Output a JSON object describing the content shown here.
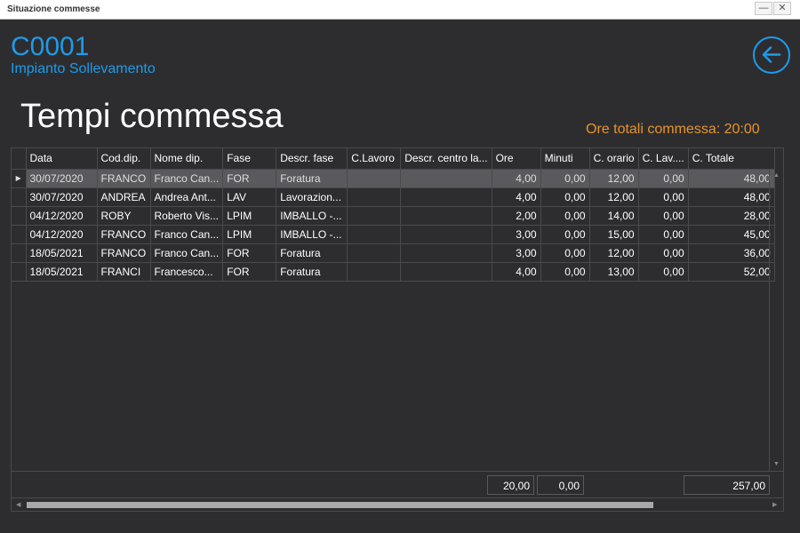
{
  "window": {
    "title": "Situazione commesse",
    "minimize": "—",
    "close": "✕"
  },
  "header": {
    "code": "C0001",
    "description": "Impianto Sollevamento",
    "heading": "Tempi commessa",
    "total_hours": "Ore totali commessa: 20:00"
  },
  "colors": {
    "accent": "#1e9be8",
    "total": "#e8932a",
    "background": "#2d2d30"
  },
  "table": {
    "columns": [
      "Data",
      "Cod.dip.",
      "Nome dip.",
      "Fase",
      "Descr. fase",
      "C.Lavoro",
      "Descr. centro la...",
      "Ore",
      "Minuti",
      "C. orario",
      "C. Lav....",
      "C. Totale"
    ],
    "rows": [
      [
        "30/07/2020",
        "FRANCO",
        "Franco Can...",
        "FOR",
        "Foratura",
        "",
        "",
        "4,00",
        "0,00",
        "12,00",
        "0,00",
        "48,00"
      ],
      [
        "30/07/2020",
        "ANDREA",
        "Andrea Ant...",
        "LAV",
        "Lavorazion...",
        "",
        "",
        "4,00",
        "0,00",
        "12,00",
        "0,00",
        "48,00"
      ],
      [
        "04/12/2020",
        "ROBY",
        "Roberto Vis...",
        "LPIM",
        "IMBALLO -...",
        "",
        "",
        "2,00",
        "0,00",
        "14,00",
        "0,00",
        "28,00"
      ],
      [
        "04/12/2020",
        "FRANCO",
        "Franco Can...",
        "LPIM",
        "IMBALLO -...",
        "",
        "",
        "3,00",
        "0,00",
        "15,00",
        "0,00",
        "45,00"
      ],
      [
        "18/05/2021",
        "FRANCO",
        "Franco Can...",
        "FOR",
        "Foratura",
        "",
        "",
        "3,00",
        "0,00",
        "12,00",
        "0,00",
        "36,00"
      ],
      [
        "18/05/2021",
        "FRANCI",
        "Francesco...",
        "FOR",
        "Foratura",
        "",
        "",
        "4,00",
        "0,00",
        "13,00",
        "0,00",
        "52,00"
      ]
    ],
    "selected_row": 0,
    "row_indicator": "▶",
    "totals": {
      "ore": "20,00",
      "minuti": "0,00",
      "c_totale": "257,00"
    }
  },
  "icons": {
    "back": "arrow-left-circle-icon"
  }
}
